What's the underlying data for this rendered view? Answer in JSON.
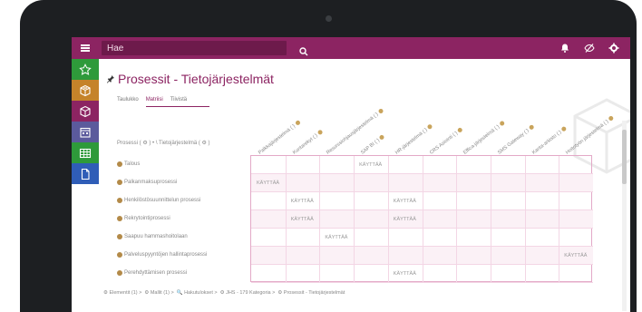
{
  "app": {
    "search_placeholder": "Hae"
  },
  "colors": {
    "brand": "#8c2462",
    "nav_star": "#2e9a3a",
    "nav_cube1": "#c5832a",
    "nav_cube2": "#8c2462",
    "nav_calendar": "#5b5a9c",
    "nav_table": "#2e9a3a",
    "nav_document": "#2f5db7"
  },
  "topbar_icons": [
    "bell-icon",
    "eye-slash-icon",
    "gear-icon"
  ],
  "nav_items": [
    {
      "name": "star-icon"
    },
    {
      "name": "cube-icon"
    },
    {
      "name": "cube-outline-icon"
    },
    {
      "name": "calendar-icon"
    },
    {
      "name": "table-icon"
    },
    {
      "name": "document-icon"
    }
  ],
  "page": {
    "title": "Prosessit - Tietojärjestelmät"
  },
  "tabs": [
    {
      "label": "Taulukko",
      "active": false
    },
    {
      "label": "Matriisi",
      "active": true
    },
    {
      "label": "Tiivistä",
      "active": false
    }
  ],
  "row_header": "Prosessi ( ⚙ ) • \\ Tietojärjestelmä ( ⚙ )",
  "columns": [
    "Palkkajärjestelmä ( )",
    "Kuntarekyt ( )",
    "Resurssiohjausjärjestelmä ( )",
    "SAP BI ( )",
    "HR-järjestelmä ( )",
    "CRS Asiointi ( )",
    "Effica-järjestelmä ( )",
    "SMS Gateway ( )",
    "Kanta-arkisto ( )",
    "Hoitotyön järjestelmä ( )"
  ],
  "rows": [
    {
      "label": "Talous",
      "cells": {
        "3": "KÄYTTÄÄ"
      }
    },
    {
      "label": "Palkanmaksuprosessi",
      "cells": {
        "0": "KÄYTTÄÄ"
      }
    },
    {
      "label": "Henkilöstösuunnittelun prosessi",
      "cells": {
        "1": "KÄYTTÄÄ",
        "4": "KÄYTTÄÄ"
      }
    },
    {
      "label": "Rekrytointiprosessi",
      "cells": {
        "1": "KÄYTTÄÄ",
        "4": "KÄYTTÄÄ"
      }
    },
    {
      "label": "Saapuu hammashoitolaan",
      "cells": {
        "2": "KÄYTTÄÄ"
      }
    },
    {
      "label": "Palveluspyyntöjen hallintaprosessi",
      "cells": {
        "9": "KÄYTTÄÄ"
      }
    },
    {
      "label": "Perehdyttämisen prosessi",
      "cells": {
        "4": "KÄYTTÄÄ"
      }
    }
  ],
  "breadcrumb": [
    "⚙ Elementit (1) >",
    "⚙ Mallit (1) >",
    "🔍 Hakutulokset >",
    "⚙ JHS - 179 Kategoria >",
    "⚙ Prosessit - Tietojärjestelmät"
  ]
}
